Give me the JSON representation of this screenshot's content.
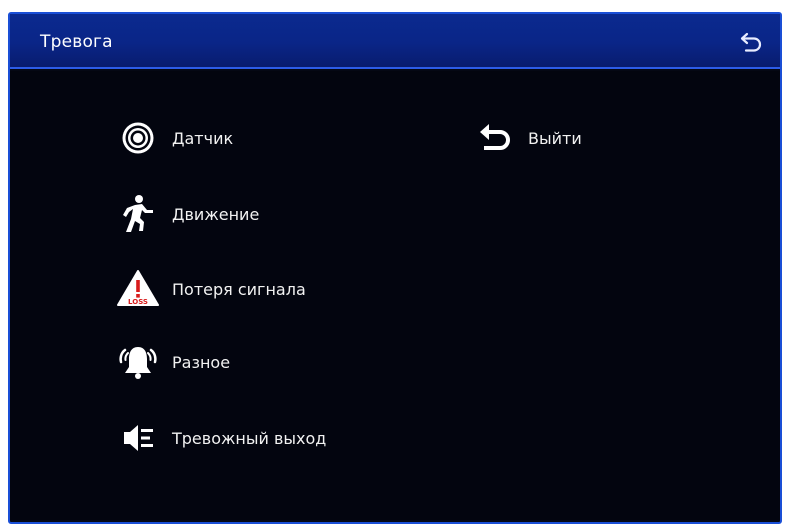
{
  "window": {
    "title": "Тревога"
  },
  "header": {
    "back_icon": "return-arrow-icon"
  },
  "menu": {
    "items": [
      {
        "label": "Датчик",
        "icon": "sensor-icon"
      },
      {
        "label": "Движение",
        "icon": "running-person-icon"
      },
      {
        "label": "Потеря сигнала",
        "icon": "video-loss-warning-icon",
        "icon_text": "LOSS"
      },
      {
        "label": "Разное",
        "icon": "alarm-bell-icon"
      },
      {
        "label": "Тревожный выход",
        "icon": "alarm-output-icon"
      },
      {
        "label": "Выйти",
        "icon": "exit-arrow-icon"
      }
    ]
  },
  "colors": {
    "titlebar": "#0a2587",
    "border": "#1a4fd6",
    "background": "#03050f",
    "text": "#f2f2f2",
    "warning_red": "#d81c1c"
  }
}
